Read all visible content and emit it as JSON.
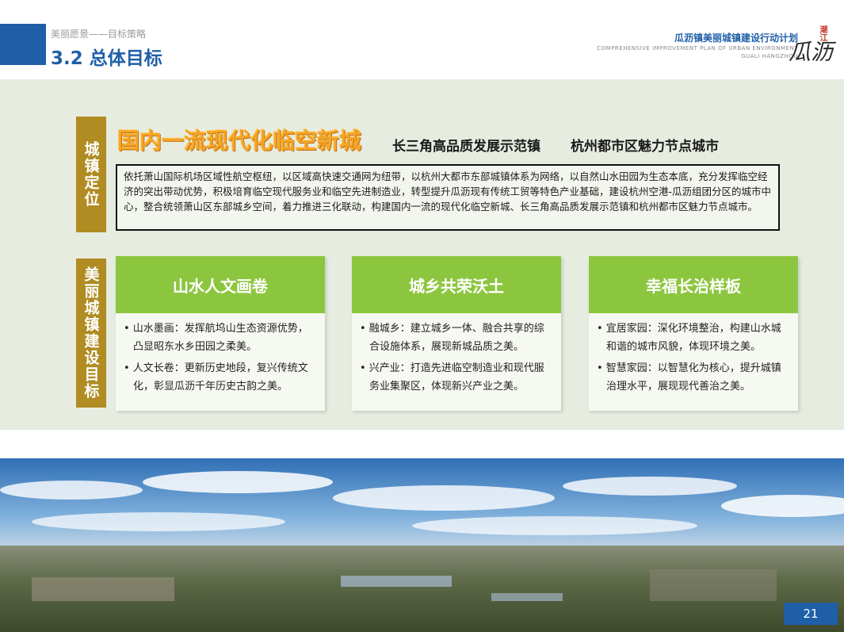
{
  "header": {
    "breadcrumb": "美丽愿景——目标策略",
    "title": "3.2 总体目标",
    "plan_title": "瓜沥镇美丽城镇建设行动计划",
    "plan_en_line1": "COMPREHENSIVE IMPROVEMENT PLAN OF URBAN ENVIRONMENT",
    "plan_en_line2": "GUALI HANGZHOU",
    "seal_text": "潮江",
    "seal_glyph": "瓜沥"
  },
  "positioning": {
    "label": "城镇定位",
    "headline": "国内一流现代化临空新城",
    "sub1": "长三角高品质发展示范镇",
    "sub2": "杭州都市区魅力节点城市",
    "description": "依托萧山国际机场区域性航空枢纽，以区域高快速交通网为纽带，以杭州大都市东部城镇体系为网络，以自然山水田园为生态本底，充分发挥临空经济的突出带动优势，积极培育临空现代服务业和临空先进制造业，转型提升瓜沥现有传统工贸等特色产业基础，建设杭州空港-瓜沥组团分区的城市中心，整合统领萧山区东部城乡空间，着力推进三化联动，构建国内一流的现代化临空新城、长三角高品质发展示范镇和杭州都市区魅力节点城市。"
  },
  "goals": {
    "label": "美丽城镇建设目标",
    "cards": [
      {
        "title": "山水人文画卷",
        "items": [
          "• 山水墨画：发挥航坞山生态资源优势，凸显昭东水乡田园之柔美。",
          "• 人文长卷：更新历史地段，复兴传统文化，彰显瓜沥千年历史古韵之美。"
        ]
      },
      {
        "title": "城乡共荣沃土",
        "items": [
          "• 融城乡：建立城乡一体、融合共享的综合设施体系，展现新城品质之美。",
          "• 兴产业：打造先进临空制造业和现代服务业集聚区，体现新兴产业之美。"
        ]
      },
      {
        "title": "幸福长治样板",
        "items": [
          "• 宜居家园：深化环境整治，构建山水城和谐的城市风貌，体现环境之美。",
          "• 智慧家园：以智慧化为核心，提升城镇治理水平，展现现代善治之美。"
        ]
      }
    ]
  },
  "footer": {
    "page_number": "21"
  }
}
